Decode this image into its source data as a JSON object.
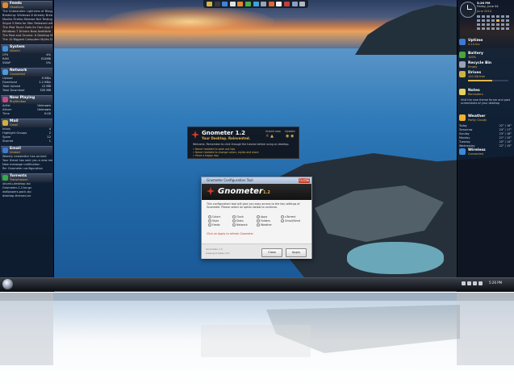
{
  "left_sidebar": {
    "sections": [
      {
        "title": "Feeds",
        "subtitle": "Headlines",
        "color": "#e08a2a",
        "lines": [
          "The Unbearable Lightness of Blogging - Ars Technica",
          "Breaking: Windows 8 Already Breaking Records",
          "Mozilla Firefox Release Not Testing Tonight",
          "Skype 5 Beta for Mac Released with Screen Sharing",
          "The iPod Touch Gets Its Own App Store",
          "Windows 7 Drivers Now Available",
          "The Post and Gnome: A Desktop Monitor",
          "The 10 Biggest Computer Myths Debunked"
        ]
      },
      {
        "title": "System",
        "subtitle": "Ubuntu",
        "color": "#3f8fd6",
        "lines": [
          [
            "CPU",
            "4%"
          ],
          [
            "RAM",
            "512MB"
          ],
          [
            "SWAP",
            "0%"
          ]
        ]
      },
      {
        "title": "Network",
        "subtitle": "Connected",
        "color": "#4a9be0",
        "lines": [
          [
            "Upload",
            "0 KB/s"
          ],
          [
            "Download",
            "1.2 KB/s"
          ],
          [
            "Total Upload",
            "12 MB"
          ],
          [
            "Total Download",
            "320 MB"
          ]
        ]
      },
      {
        "title": "Now Playing",
        "subtitle": "Rhythmbox",
        "color": "#c04a8a",
        "lines": [
          [
            "Artist",
            "Unknown"
          ],
          [
            "Album",
            "Unknown"
          ],
          [
            "Time",
            "0:00"
          ]
        ]
      },
      {
        "title": "Mail",
        "subtitle": "Gmail",
        "color": "#d0b040",
        "lines": [
          [
            "Inbox",
            "4"
          ],
          [
            "Highlight Groups",
            "2"
          ],
          [
            "Spam",
            "12"
          ],
          [
            "Starred",
            "1"
          ]
        ]
      },
      {
        "title": "Email",
        "subtitle": "Unread",
        "color": "#3a7ad0",
        "lines": [
          "Weekly newsletter has arrived",
          "Your friend has sent you a new message",
          "New message notification",
          "Re: Gnometer configuration"
        ]
      },
      {
        "title": "Torrents",
        "subtitle": "Transmission",
        "color": "#38a848",
        "lines": [
          "ubuntu-desktop.iso",
          "Gnometer-1.2.tar.gz",
          "wallpapers-pack.zip",
          "desktop-themes.tar"
        ]
      }
    ]
  },
  "toolbar": {
    "icons": [
      {
        "name": "folder-icon",
        "color": "#d8b24a"
      },
      {
        "name": "terminal-icon",
        "color": "#3a3a3a"
      },
      {
        "name": "browser-icon",
        "color": "#3f86d6"
      },
      {
        "name": "mail-icon",
        "color": "#e0e0e0"
      },
      {
        "name": "music-icon",
        "color": "#e08a2a"
      },
      {
        "name": "photos-icon",
        "color": "#4ab04a"
      },
      {
        "name": "chat-icon",
        "color": "#40a0e0"
      },
      {
        "name": "settings-icon",
        "color": "#9aa4b4"
      },
      {
        "name": "firefox-icon",
        "color": "#e06a2a"
      },
      {
        "name": "text-editor-icon",
        "color": "#f0f0f0"
      },
      {
        "name": "video-icon",
        "color": "#c04040"
      },
      {
        "name": "calculator-icon",
        "color": "#8aa0c0"
      },
      {
        "name": "trash-icon",
        "color": "#b0b8c4"
      }
    ]
  },
  "right_sidebar": {
    "time": "5:26 PM",
    "date": "Friday, June 04",
    "calendar_month": "June 2010",
    "sections": [
      {
        "title": "Uptime",
        "subtitle": "2:14 hrs",
        "color": "#3a7ad0"
      },
      {
        "title": "Battery",
        "subtitle": "100%",
        "color": "#48a838"
      },
      {
        "title": "Recycle Bin",
        "subtitle": "Empty",
        "color": "#9aa4b4"
      },
      {
        "title": "Drives",
        "subtitle": "120 GB free",
        "color": "#d0b040"
      },
      {
        "title": "Notes",
        "subtitle": "Reminders",
        "color": "#e8d060"
      },
      {
        "title": "Weather",
        "subtitle": "Partly Cloudy",
        "color": "#f0b030"
      },
      {
        "title": "Wireless",
        "subtitle": "Connected",
        "color": "#3a8ad8"
      }
    ],
    "note_text": "Visit the new theme forum and post screenshots of your desktop",
    "forecast": [
      [
        "Today",
        "22° / 16°"
      ],
      [
        "Tomorrow",
        "24° / 17°"
      ],
      [
        "Sunday",
        "23° / 16°"
      ],
      [
        "Monday",
        "21° / 15°"
      ],
      [
        "Tuesday",
        "20° / 14°"
      ],
      [
        "Wednesday",
        "22° / 15°"
      ]
    ]
  },
  "banner": {
    "title": "Gnometer 1.2",
    "tagline": "Your Desktop. Reinvented.",
    "col1": "Install new",
    "col2": "Update",
    "description": "Welcome. Remember to click through the tutorial before using on desktop.",
    "links": [
      "» Never hesitate to seek out tips",
      "» Never hesitate to change colors, styles and more",
      "» Have a happy day"
    ]
  },
  "dialog": {
    "window_title": "Gnometer Configuration Tool",
    "close_label": "CLOSE",
    "app_name": "Gnometer",
    "version": "1.2",
    "intro": "This configuration tool will give you easy access to the key settings of Gnometer. Please select an option below to continue.",
    "options": [
      [
        "Colors",
        "Clock",
        "Apps",
        "uTorrent"
      ],
      [
        "Style",
        "Disks",
        "Folders",
        "Gmail/Send"
      ],
      [
        "Feeds",
        "Network",
        "Weather"
      ]
    ],
    "note": "Click on Apply to refresh Gnometer",
    "footer_line1": "Gnometer 1.2",
    "footer_line2": "www.gnometer.com",
    "btn_close": "Close",
    "btn_apply": "Apply"
  },
  "taskbar": {
    "clock": "5:26 PM"
  }
}
